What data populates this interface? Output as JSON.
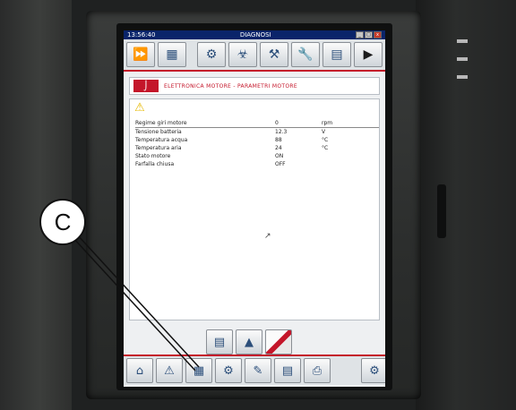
{
  "window": {
    "title_left": "13:56:40",
    "title_center": "DIAGNOSI",
    "controls": [
      "_",
      "□",
      "x"
    ]
  },
  "toolbar": {
    "icons": [
      "fast-forward-icon",
      "grid-icon",
      "diagnostic-icon",
      "sensor-icon",
      "tools-icon",
      "wrench-icon",
      "chart-icon",
      "play-icon"
    ]
  },
  "breadcrumb": {
    "text": "ELETTRONICA MOTORE - PARAMETRI MOTORE"
  },
  "table": {
    "rows": [
      {
        "name": "Regime giri motore",
        "value": "0",
        "unit": "rpm"
      },
      {
        "name": "Tensione batteria",
        "value": "12.3",
        "unit": "V"
      },
      {
        "name": "Temperatura acqua",
        "value": "88",
        "unit": "°C"
      },
      {
        "name": "Temperatura aria",
        "value": "24",
        "unit": "°C"
      },
      {
        "name": "Stato motore",
        "value": "ON",
        "unit": ""
      },
      {
        "name": "Farfalla chiusa",
        "value": "OFF",
        "unit": ""
      }
    ]
  },
  "callout": {
    "label": "C"
  },
  "colors": {
    "accent": "#c4162a",
    "titlebar": "#0a246a"
  }
}
